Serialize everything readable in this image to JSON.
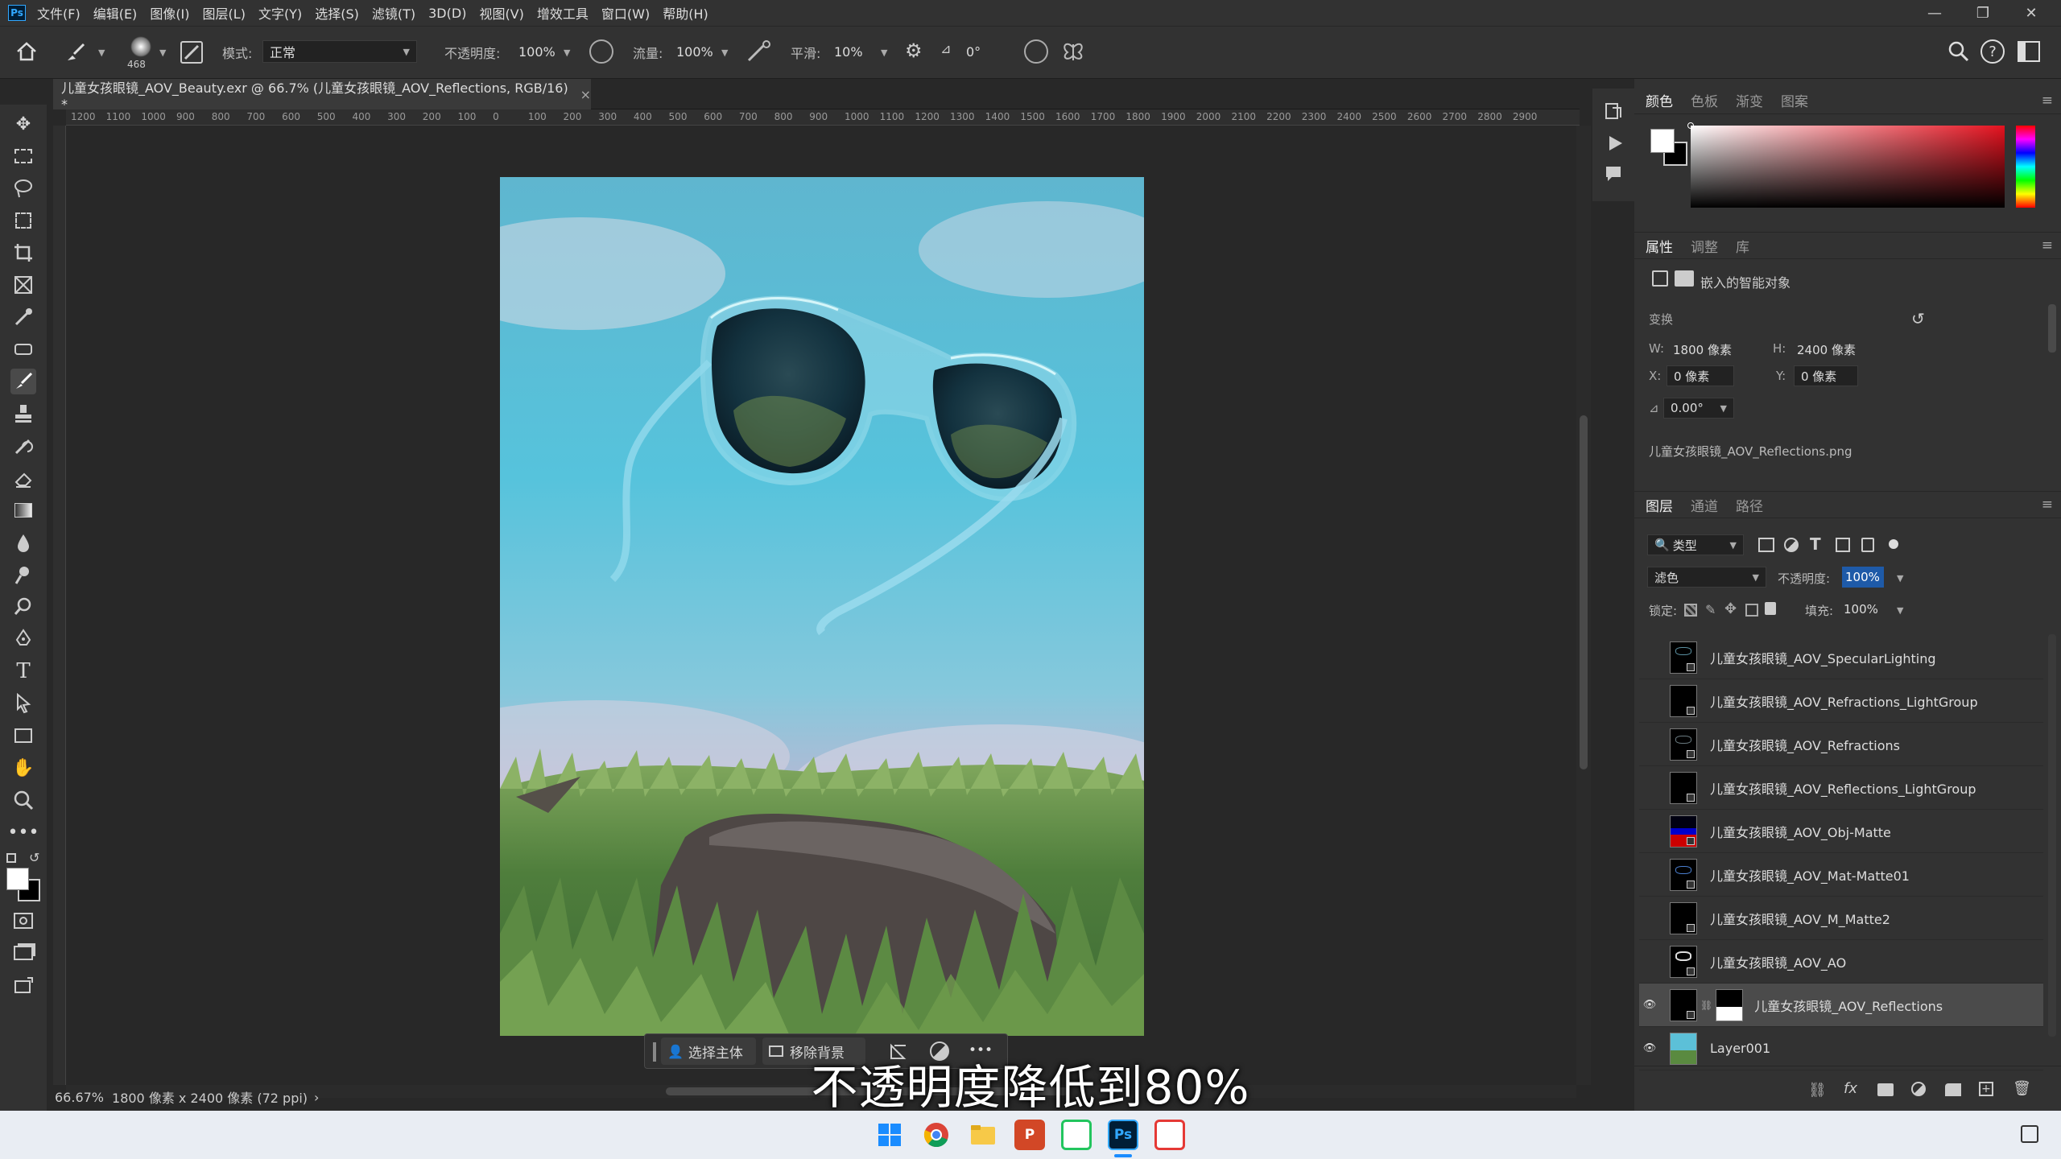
{
  "app": {
    "logo_text": "Ps"
  },
  "menu": [
    "文件(F)",
    "编辑(E)",
    "图像(I)",
    "图层(L)",
    "文字(Y)",
    "选择(S)",
    "滤镜(T)",
    "3D(D)",
    "视图(V)",
    "增效工具",
    "窗口(W)",
    "帮助(H)"
  ],
  "window_controls": {
    "minimize": "—",
    "restore": "❐",
    "close": "✕"
  },
  "options": {
    "brush_size": "468",
    "mode_label": "模式:",
    "mode_value": "正常",
    "opacity_label": "不透明度:",
    "opacity_value": "100%",
    "flow_label": "流量:",
    "flow_value": "100%",
    "smoothing_label": "平滑:",
    "smoothing_value": "10%",
    "angle_symbol": "⊿",
    "angle_value": "0°"
  },
  "document": {
    "tab_title": "儿童女孩眼镜_AOV_Beauty.exr @ 66.7% (儿童女孩眼镜_AOV_Reflections, RGB/16) *",
    "close": "×"
  },
  "ruler_labels": [
    "1200",
    "1100",
    "1000",
    "900",
    "800",
    "700",
    "600",
    "500",
    "400",
    "300",
    "200",
    "100",
    "0",
    "100",
    "200",
    "300",
    "400",
    "500",
    "600",
    "700",
    "800",
    "900",
    "1000",
    "1100",
    "1200",
    "1300",
    "1400",
    "1500",
    "1600",
    "1700",
    "1800",
    "1900",
    "2000",
    "2100",
    "2200",
    "2300",
    "2400",
    "2500",
    "2600",
    "2700",
    "2800",
    "2900"
  ],
  "status": {
    "zoom": "66.67%",
    "doc_info": "1800 像素 x 2400 像素 (72 ppi)",
    "arrow": "›"
  },
  "context_bar": {
    "select_subject": "选择主体",
    "remove_bg": "移除背景",
    "more": "•••"
  },
  "subtitle": "不透明度降低到80%",
  "color_panel": {
    "tabs": [
      "颜色",
      "色板",
      "渐变",
      "图案"
    ]
  },
  "properties_panel": {
    "tabs": [
      "属性",
      "调整",
      "库"
    ],
    "object_type": "嵌入的智能对象",
    "transform_label": "变换",
    "w_label": "W:",
    "w_value": "1800 像素",
    "h_label": "H:",
    "h_value": "2400 像素",
    "x_label": "X:",
    "x_value": "0 像素",
    "y_label": "Y:",
    "y_value": "0 像素",
    "angle_value": "0.00°",
    "filename": "儿童女孩眼镜_AOV_Reflections.png"
  },
  "layers_panel": {
    "tabs": [
      "图层",
      "通道",
      "路径"
    ],
    "filter_label": "类型",
    "blend_mode": "滤色",
    "opacity_label": "不透明度:",
    "opacity_value": "100%",
    "lock_label": "锁定:",
    "fill_label": "填充:",
    "fill_value": "100%",
    "layers": [
      {
        "name": "儿童女孩眼镜_AOV_SpecularLighting",
        "visible": false
      },
      {
        "name": "儿童女孩眼镜_AOV_Refractions_LightGroup",
        "visible": false
      },
      {
        "name": "儿童女孩眼镜_AOV_Refractions",
        "visible": false
      },
      {
        "name": "儿童女孩眼镜_AOV_Reflections_LightGroup",
        "visible": false
      },
      {
        "name": "儿童女孩眼镜_AOV_Obj-Matte",
        "visible": false
      },
      {
        "name": "儿童女孩眼镜_AOV_Mat-Matte01",
        "visible": false
      },
      {
        "name": "儿童女孩眼镜_AOV_M_Matte2",
        "visible": false
      },
      {
        "name": "儿童女孩眼镜_AOV_AO",
        "visible": false
      },
      {
        "name": "儿童女孩眼镜_AOV_Reflections",
        "visible": true,
        "selected": true
      },
      {
        "name": "Layer001",
        "visible": true
      }
    ],
    "footer_icons": [
      "link-icon",
      "fx-icon",
      "mask-icon",
      "adjustment-icon",
      "folder-icon",
      "new-layer-icon",
      "trash-icon"
    ],
    "fx_text": "fx"
  },
  "taskbar": {
    "ppt": "P",
    "ps": "Ps"
  },
  "colors": {
    "accent": "#31a8ff",
    "panel_bg": "#323232",
    "canvas_bg": "#282828",
    "selected_layer": "#4b4b4b"
  }
}
